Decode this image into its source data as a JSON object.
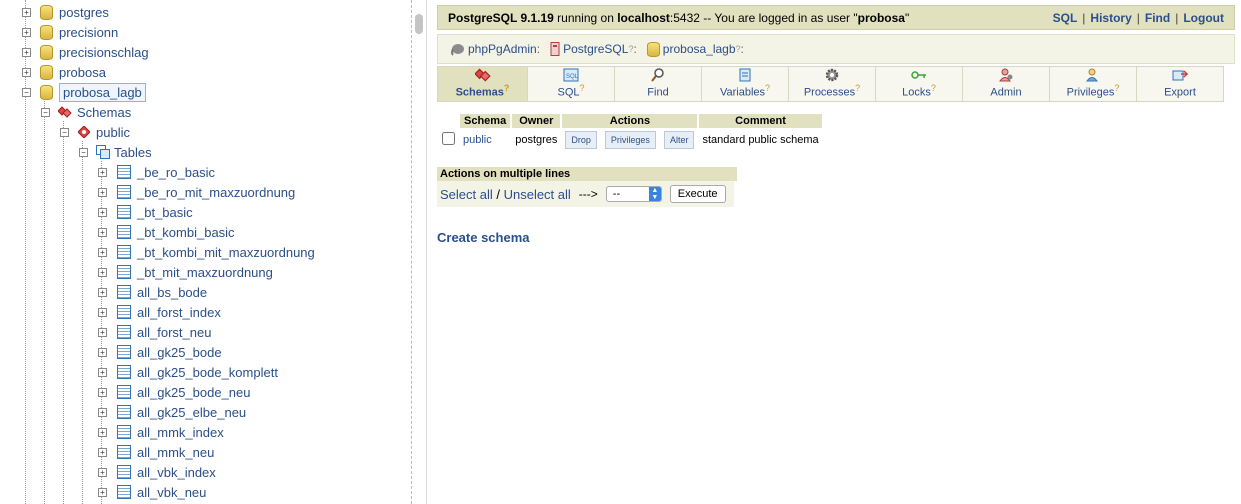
{
  "tree": {
    "databases": [
      "postgres",
      "precisionn",
      "precisionschlag",
      "probosa",
      "probosa_lagb"
    ],
    "schemas_label": "Schemas",
    "schema_name": "public",
    "tables_label": "Tables",
    "tables": [
      "_be_ro_basic",
      "_be_ro_mit_maxzuordnung",
      "_bt_basic",
      "_bt_kombi_basic",
      "_bt_kombi_mit_maxzuordnung",
      "_bt_mit_maxzuordnung",
      "all_bs_bode",
      "all_forst_index",
      "all_forst_neu",
      "all_gk25_bode",
      "all_gk25_bode_komplett",
      "all_gk25_bode_neu",
      "all_gk25_elbe_neu",
      "all_mmk_index",
      "all_mmk_neu",
      "all_vbk_index",
      "all_vbk_neu"
    ]
  },
  "topbar": {
    "version": "PostgreSQL 9.1.19",
    "running_on": " running on ",
    "host": "localhost",
    "rest": ":5432 -- You are logged in as user \"",
    "user": "probosa",
    "end": "\"",
    "links": [
      "SQL",
      "History",
      "Find",
      "Logout"
    ]
  },
  "breadcrumb": {
    "items": [
      "phpPgAdmin",
      "PostgreSQL",
      "probosa_lagb"
    ],
    "help_mark": "?",
    "colon": ":"
  },
  "tabs": [
    {
      "label": "Schemas",
      "help": "?"
    },
    {
      "label": "SQL",
      "help": "?"
    },
    {
      "label": "Find",
      "help": ""
    },
    {
      "label": "Variables",
      "help": "?"
    },
    {
      "label": "Processes",
      "help": "?"
    },
    {
      "label": "Locks",
      "help": "?"
    },
    {
      "label": "Admin",
      "help": ""
    },
    {
      "label": "Privileges",
      "help": "?"
    },
    {
      "label": "Export",
      "help": ""
    }
  ],
  "schema_table": {
    "headers": [
      "Schema",
      "Owner",
      "Actions",
      "Comment"
    ],
    "row": {
      "schema": "public",
      "owner": "postgres",
      "actions": [
        "Drop",
        "Privileges",
        "Alter"
      ],
      "comment": "standard public schema"
    }
  },
  "multi_actions": {
    "title": "Actions on multiple lines",
    "select_all": "Select all",
    "slash": " / ",
    "unselect_all": "Unselect all",
    "arrow": "--->",
    "select_value": "--",
    "execute": "Execute"
  },
  "create_schema": "Create schema"
}
